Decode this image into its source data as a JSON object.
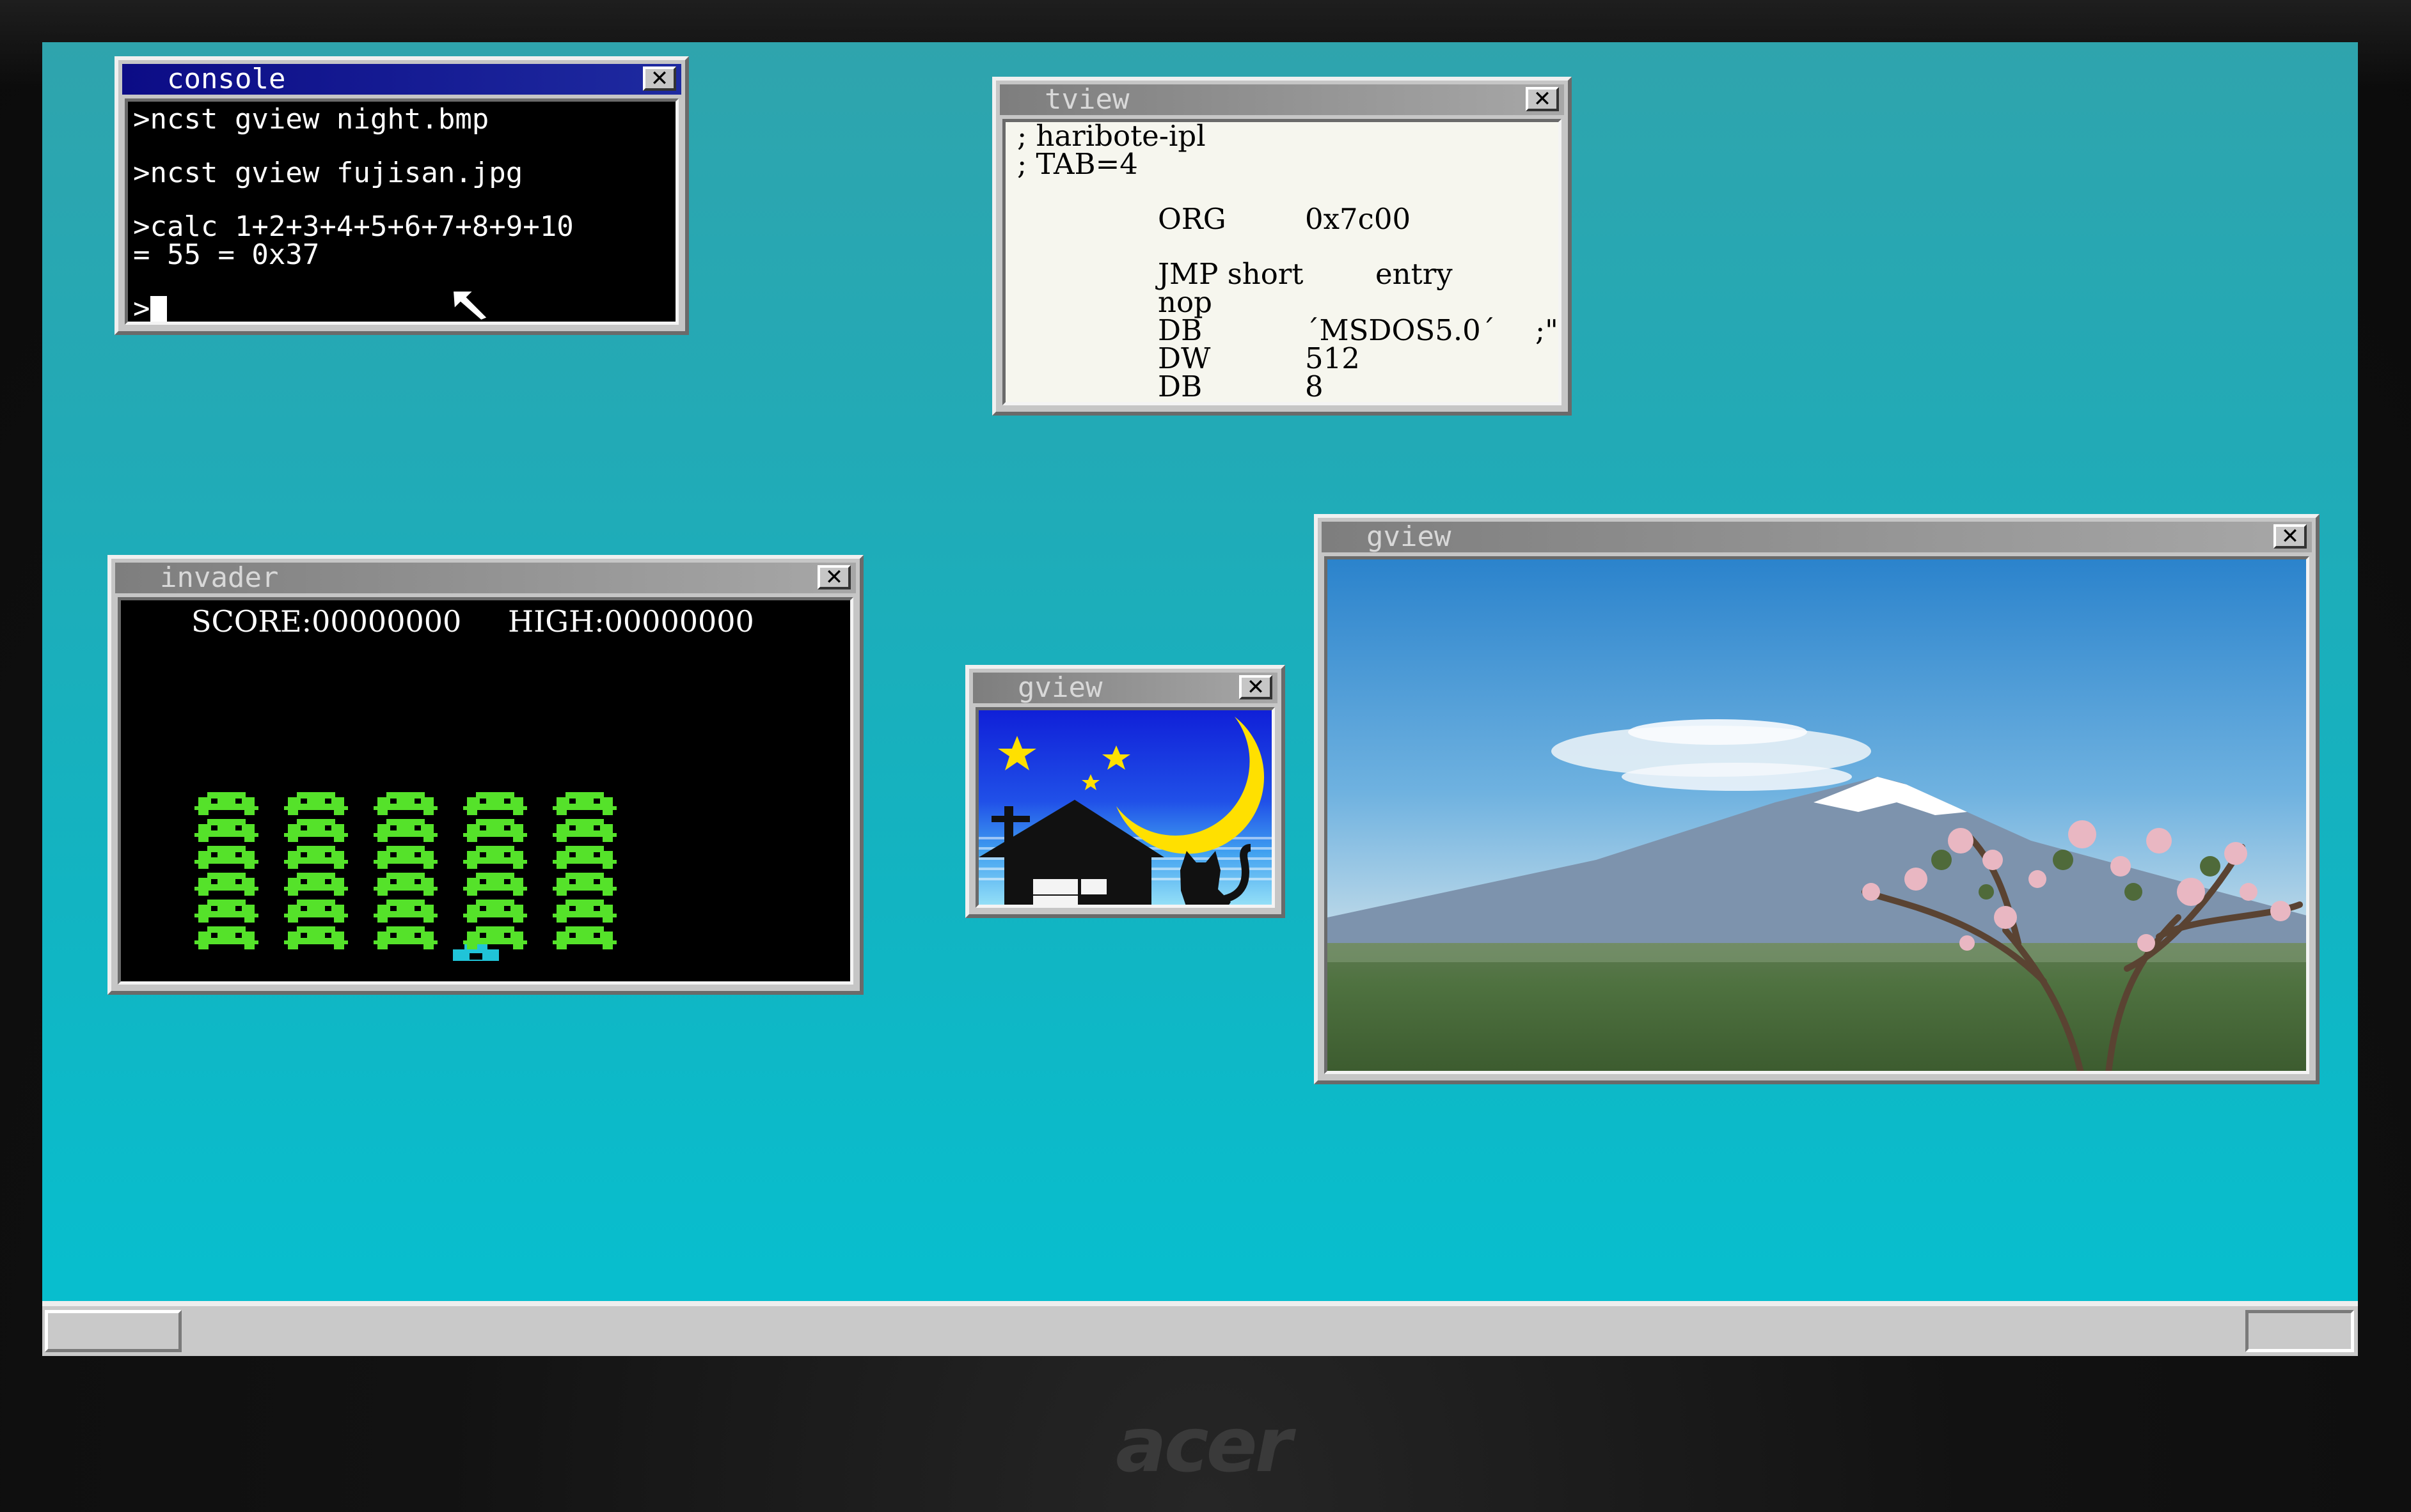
{
  "monitor": {
    "brand": "acer"
  },
  "windows": {
    "console": {
      "title": "console",
      "lines": [
        ">ncst gview night.bmp",
        ">ncst gview fujisan.jpg",
        ">calc 1+2+3+4+5+6+7+8+9+10",
        "= 55 = 0x37"
      ],
      "prompt": ">"
    },
    "tview": {
      "title": "tview",
      "lines": {
        "l1": "; haribote-ipl",
        "l2": "; TAB=4",
        "l3a": "ORG",
        "l3b": "0x7c00",
        "l4a": "JMP short",
        "l4b": "entry",
        "l5a": "nop",
        "l6a": "DB",
        "l6b": "´MSDOS5.0´",
        "l6c": ";\"",
        "l7a": "DW",
        "l7b": "512",
        "l8a": "DB",
        "l8b": "8"
      }
    },
    "invader": {
      "title": "invader",
      "score_label": "SCORE:00000000",
      "high_label": "HIGH:00000000",
      "alien_rows": 6,
      "alien_cols": 5
    },
    "gview_small": {
      "title": "gview",
      "image": "night-house-cat-moon"
    },
    "gview_large": {
      "title": "gview",
      "image": "mount-fuji-cherry-tree"
    }
  },
  "colors": {
    "desktop": "#12b4c2",
    "active_title": "#0c0c86",
    "alien": "#55e22a",
    "player": "#20c4d8"
  }
}
